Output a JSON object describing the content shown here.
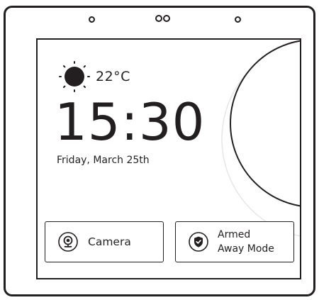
{
  "weather": {
    "icon": "sun-icon",
    "temperature": "22°C"
  },
  "clock": {
    "time": "15:30",
    "date": "Friday, March 25th"
  },
  "tiles": {
    "camera": {
      "icon": "webcam-icon",
      "label": "Camera"
    },
    "security": {
      "icon": "shield-check-icon",
      "line1": "Armed",
      "line2": "Away Mode"
    }
  },
  "colors": {
    "stroke": "#231f20",
    "background": "#ffffff",
    "decor_arc": "#e6e6e6"
  }
}
